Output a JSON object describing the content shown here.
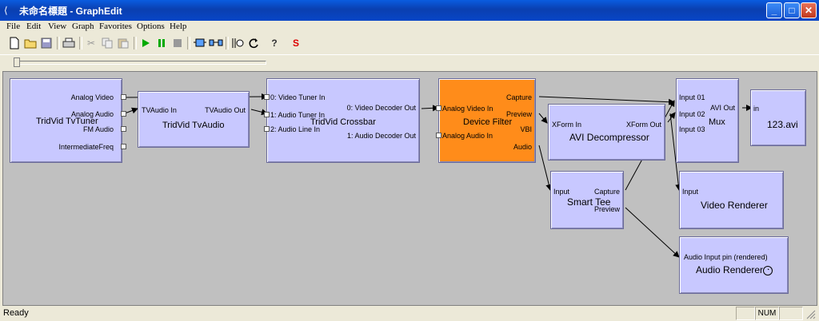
{
  "window": {
    "title": "未命名標題 - GraphEdit",
    "minimize": "_",
    "maximize": "□",
    "close": "✕",
    "icon": "graphedit-icon"
  },
  "menu": [
    "File",
    "Edit",
    "View",
    "Graph",
    "Favorites",
    "Options",
    "Help"
  ],
  "toolbar": {
    "buttons": [
      "new",
      "open",
      "save",
      "print",
      "cut",
      "copy",
      "paste",
      "play",
      "pause",
      "stop",
      "filters",
      "renderers",
      "graph",
      "refresh",
      "help",
      "seek"
    ],
    "seek_label": "S",
    "help_label": "?"
  },
  "filters": {
    "tvtuner": {
      "name": "TridVid TvTuner",
      "pins": [
        "Analog Video",
        "Analog Audio",
        "FM Audio",
        "IntermediateFreq"
      ]
    },
    "tvaudio": {
      "name": "TridVid TvAudio",
      "in": "TVAudio In",
      "out": "TVAudio Out"
    },
    "crossbar": {
      "name": "TridVid Crossbar",
      "in": [
        "0: Video Tuner In",
        "1: Audio Tuner In",
        "2: Audio Line In"
      ],
      "out": [
        "0: Video Decoder Out",
        "1: Audio Decoder Out"
      ]
    },
    "device": {
      "name": "Device Filter",
      "in": [
        "Analog Video In",
        "Analog Audio In"
      ],
      "out": [
        "Capture",
        "Preview",
        "VBI",
        "Audio"
      ]
    },
    "avidec": {
      "name": "AVI Decompressor",
      "in": "XForm In",
      "out": "XForm Out"
    },
    "mux": {
      "name": "Mux",
      "in": [
        "Input 01",
        "Input 02",
        "Input 03"
      ],
      "out": "AVI Out"
    },
    "file": {
      "name": "123.avi",
      "in": "in"
    },
    "smarttee": {
      "name": "Smart Tee",
      "in": "Input",
      "out": [
        "Capture",
        "Preview"
      ]
    },
    "videorend": {
      "name": "Video Renderer",
      "in": "Input"
    },
    "audiorend": {
      "name": "Audio Renderer",
      "in": "Audio Input pin (rendered)"
    }
  },
  "status": {
    "text": "Ready",
    "num": "NUM"
  },
  "colors": {
    "selected_filter": "#ff8c1a",
    "filter": "#c8c8ff",
    "canvas": "#c0c0c0"
  }
}
